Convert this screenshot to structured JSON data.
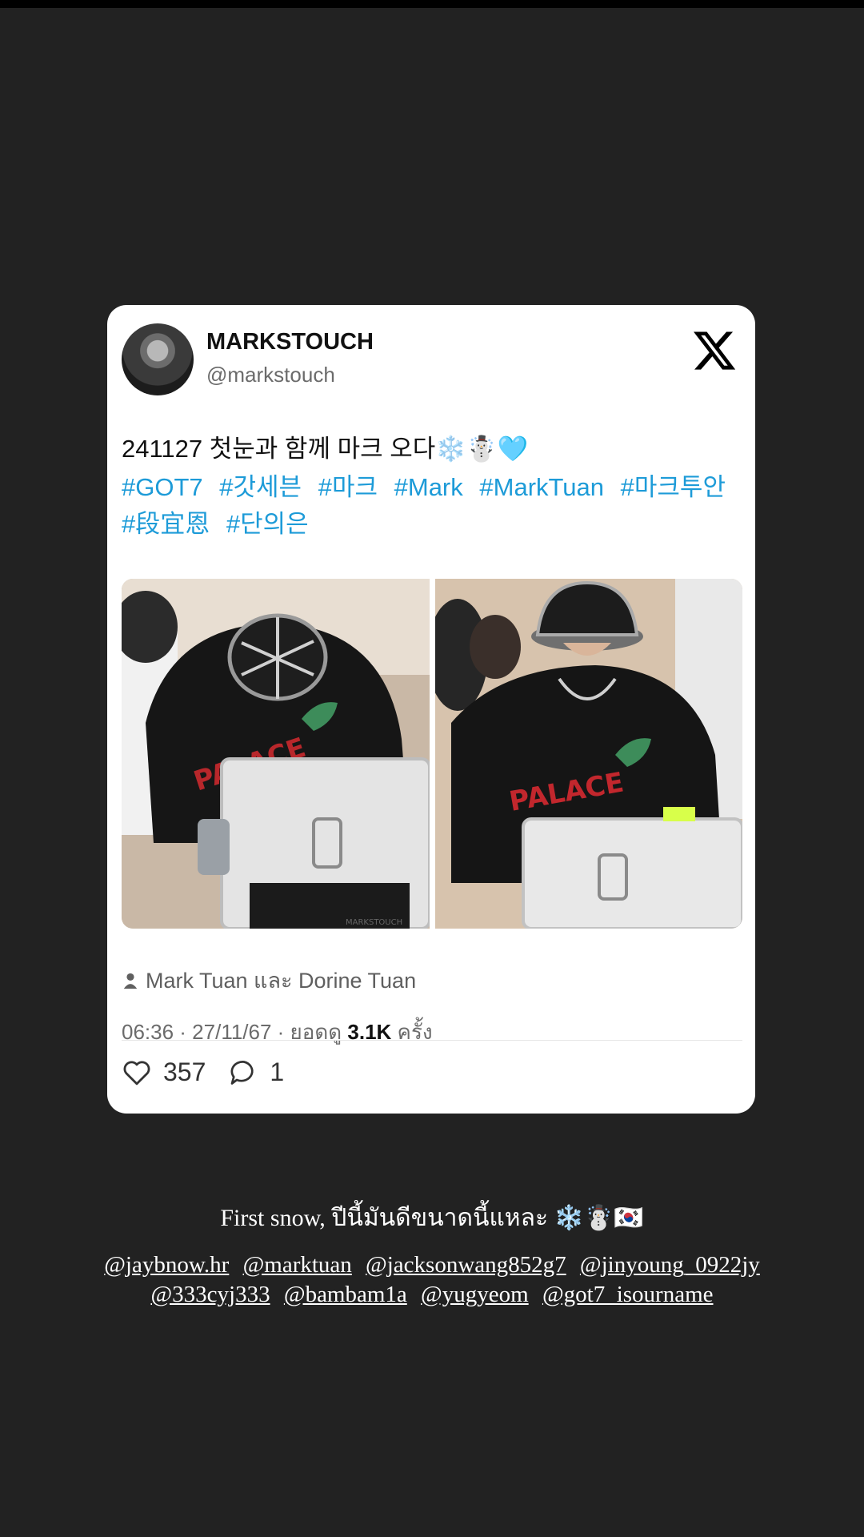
{
  "tweet": {
    "display_name": "MARKSTOUCH",
    "handle": "@markstouch",
    "text": "241127 첫눈과 함께 마크 오다❄️☃️🩵",
    "hashtags": [
      "#GOT7",
      "#갓세븐",
      "#마크",
      "#Mark",
      "#MarkTuan",
      "#마크투안",
      "#段宜恩",
      "#단의은"
    ],
    "photo_watermark": "MARKSTOUCH",
    "tagged": "Mark Tuan และ Dorine Tuan",
    "time": "06:36 · 27/11/67 · ยอดดู ",
    "views": "3.1K",
    "views_suffix": " ครั้ง",
    "likes": "357",
    "replies": "1"
  },
  "story": {
    "caption": "First snow, ปีนี้มันดีขนาดนี้แหละ ❄️☃️🇰🇷",
    "mentions": [
      "@jaybnow.hr",
      "@marktuan",
      "@jacksonwang852g7",
      "@jinyoung_0922jy",
      "@333cyj333",
      "@bambam1a",
      "@yugyeom",
      "@got7_isourname"
    ]
  },
  "colors": {
    "background": "#222222",
    "hashtag": "#1d9bd8",
    "card": "#ffffff"
  }
}
